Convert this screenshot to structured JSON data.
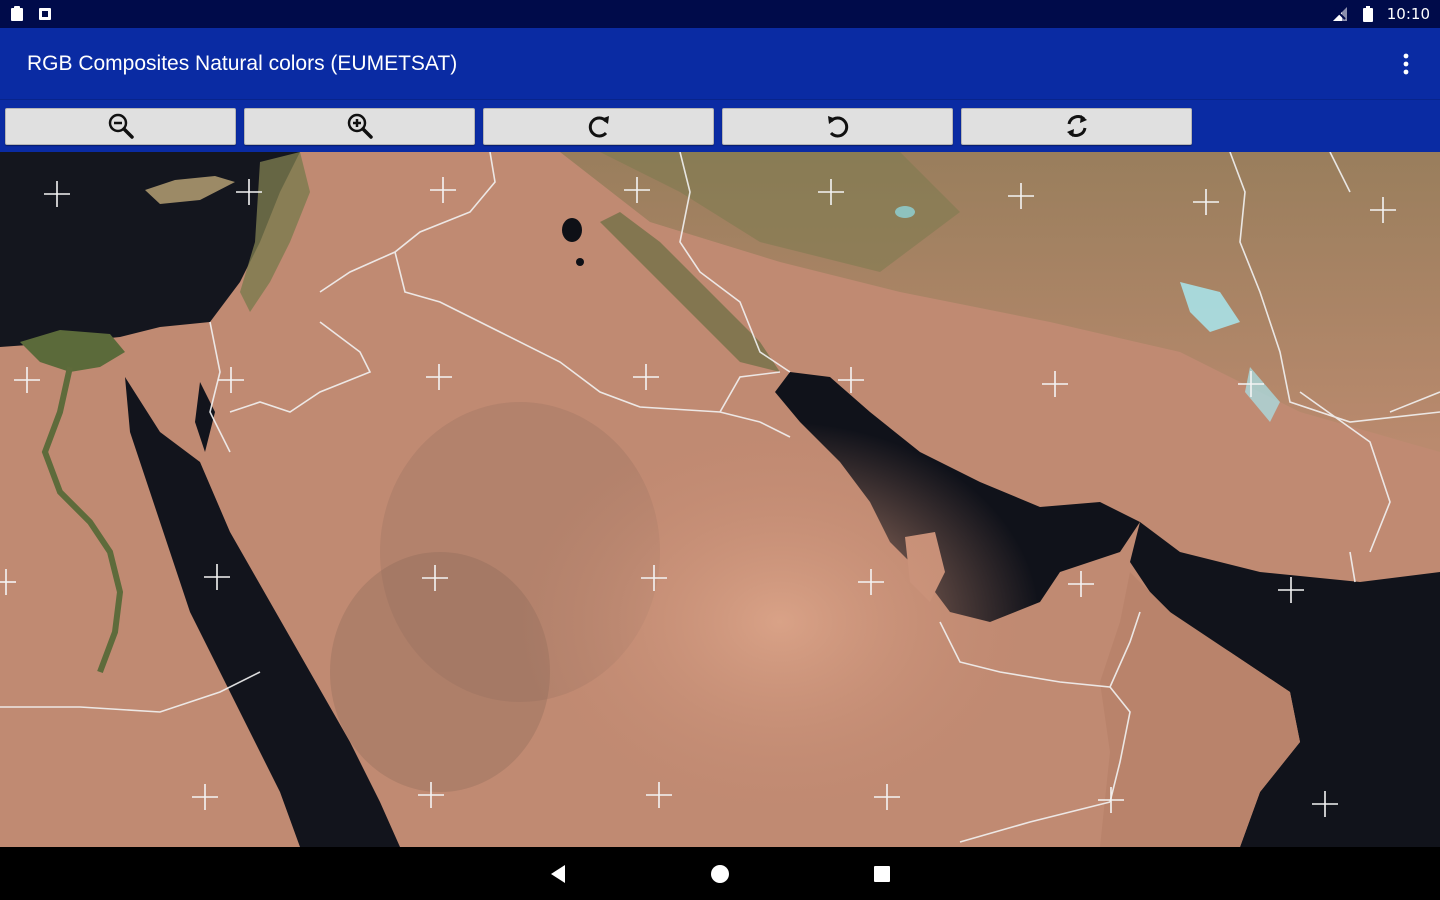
{
  "status_bar": {
    "time": "10:10",
    "left_icons": [
      "clipboard-icon",
      "notification-square-icon"
    ],
    "right_icons": [
      "signal-icon",
      "battery-icon"
    ]
  },
  "app_bar": {
    "title": "RGB Composites Natural colors (EUMETSAT)",
    "overflow_icon": "more-vert-icon"
  },
  "toolbar": {
    "buttons": [
      {
        "icon": "zoom-out-icon"
      },
      {
        "icon": "zoom-in-icon"
      },
      {
        "icon": "rotate-clockwise-icon"
      },
      {
        "icon": "rotate-counterclockwise-icon"
      },
      {
        "icon": "refresh-icon"
      }
    ]
  },
  "map": {
    "description_colors": {
      "land": "#c98d75",
      "sea": "#12141c",
      "vegetation": "#5e6b3b",
      "borders": "#f0f0f0",
      "snow": "#a8e6ee"
    }
  },
  "nav_bar": {
    "icons": [
      "back-icon",
      "home-icon",
      "recents-icon"
    ]
  }
}
